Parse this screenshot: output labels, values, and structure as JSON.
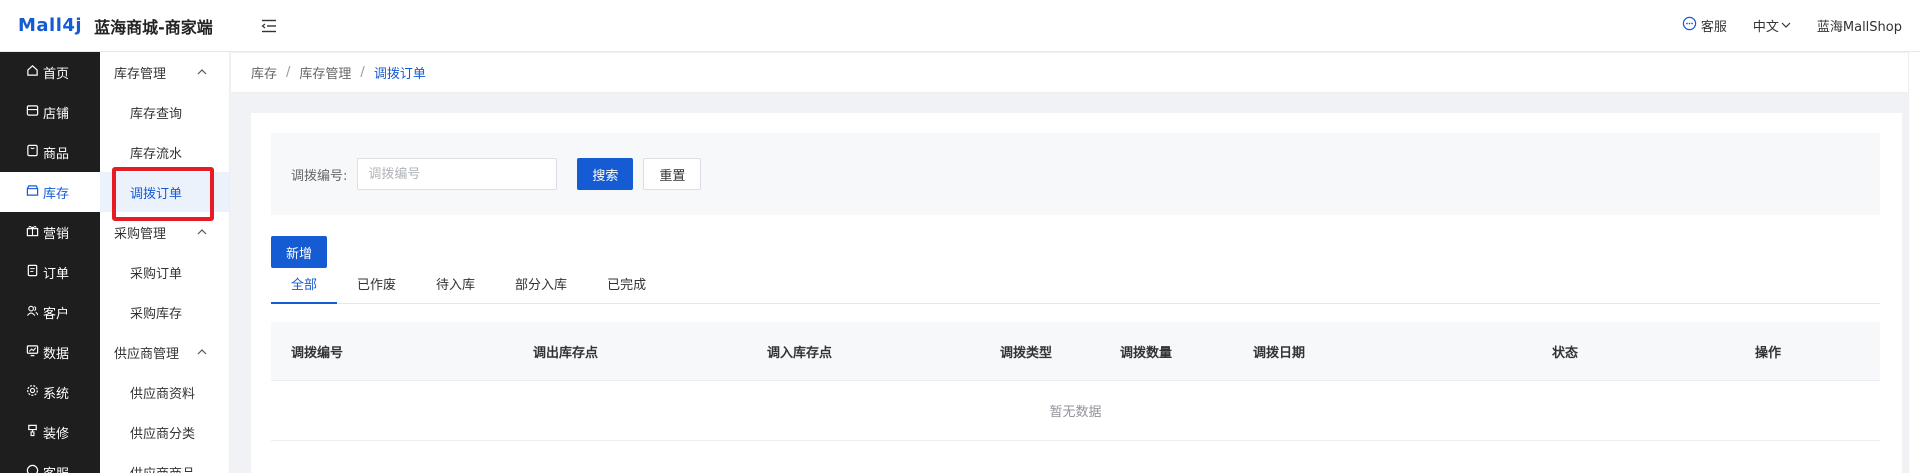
{
  "header": {
    "logo": "Mall4j",
    "title": "蓝海商城-商家端",
    "service": "客服",
    "language": "中文",
    "user": "蓝海MallShop"
  },
  "sidebar": {
    "items": [
      {
        "label": "首页",
        "icon": "home-icon"
      },
      {
        "label": "店铺",
        "icon": "shop-icon"
      },
      {
        "label": "商品",
        "icon": "goods-icon"
      },
      {
        "label": "库存",
        "icon": "stock-icon",
        "active": true
      },
      {
        "label": "营销",
        "icon": "gift-icon"
      },
      {
        "label": "订单",
        "icon": "order-icon"
      },
      {
        "label": "客户",
        "icon": "users-icon"
      },
      {
        "label": "数据",
        "icon": "chart-icon"
      },
      {
        "label": "系统",
        "icon": "gear-icon"
      },
      {
        "label": "装修",
        "icon": "brush-icon"
      },
      {
        "label": "客服",
        "icon": "chat-icon"
      }
    ]
  },
  "submenu": {
    "group1": "库存管理",
    "group1_items": [
      "库存查询",
      "库存流水",
      "调拨订单"
    ],
    "group2": "采购管理",
    "group2_items": [
      "采购订单",
      "采购库存"
    ],
    "group3": "供应商管理",
    "group3_items": [
      "供应商资料",
      "供应商分类",
      "供应商商品"
    ]
  },
  "breadcrumb": [
    "库存",
    "库存管理",
    "调拨订单"
  ],
  "search": {
    "label": "调拨编号:",
    "placeholder": "调拨编号",
    "value": "",
    "search_btn": "搜索",
    "reset_btn": "重置"
  },
  "add_btn": "新增",
  "tabs": [
    "全部",
    "已作废",
    "待入库",
    "部分入库",
    "已完成"
  ],
  "table": {
    "columns": [
      "调拨编号",
      "调出库存点",
      "调入库存点",
      "调拨类型",
      "调拨数量",
      "调拨日期",
      "状态",
      "操作"
    ],
    "empty_text": "暂无数据"
  },
  "colors": {
    "accent": "#155bd4",
    "sidebar_bg": "#1e1e1e",
    "highlight": "#e51c23"
  }
}
